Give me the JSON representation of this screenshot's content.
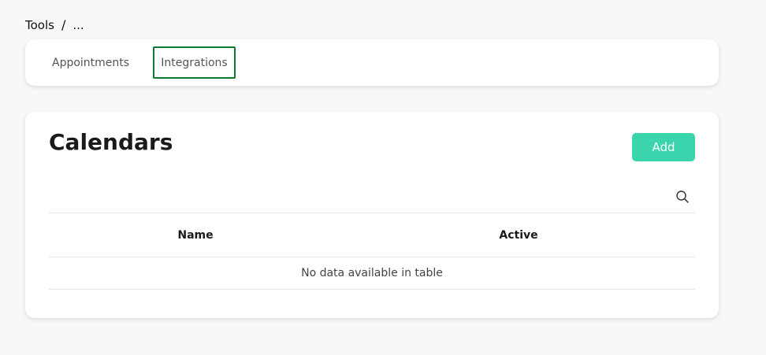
{
  "breadcrumb": {
    "root": "Tools",
    "separator": "/",
    "current": "..."
  },
  "tabs": [
    {
      "label": "Appointments",
      "active": false
    },
    {
      "label": "Integrations",
      "active": true
    }
  ],
  "calendars": {
    "title": "Calendars",
    "add_label": "Add",
    "search_icon": "search-icon",
    "columns": [
      "Name",
      "Active"
    ],
    "empty_message": "No data available in table"
  },
  "colors": {
    "accent": "#3ad4ad",
    "tab_focus_border": "#0b7a2e",
    "background": "#f7f8fa"
  }
}
